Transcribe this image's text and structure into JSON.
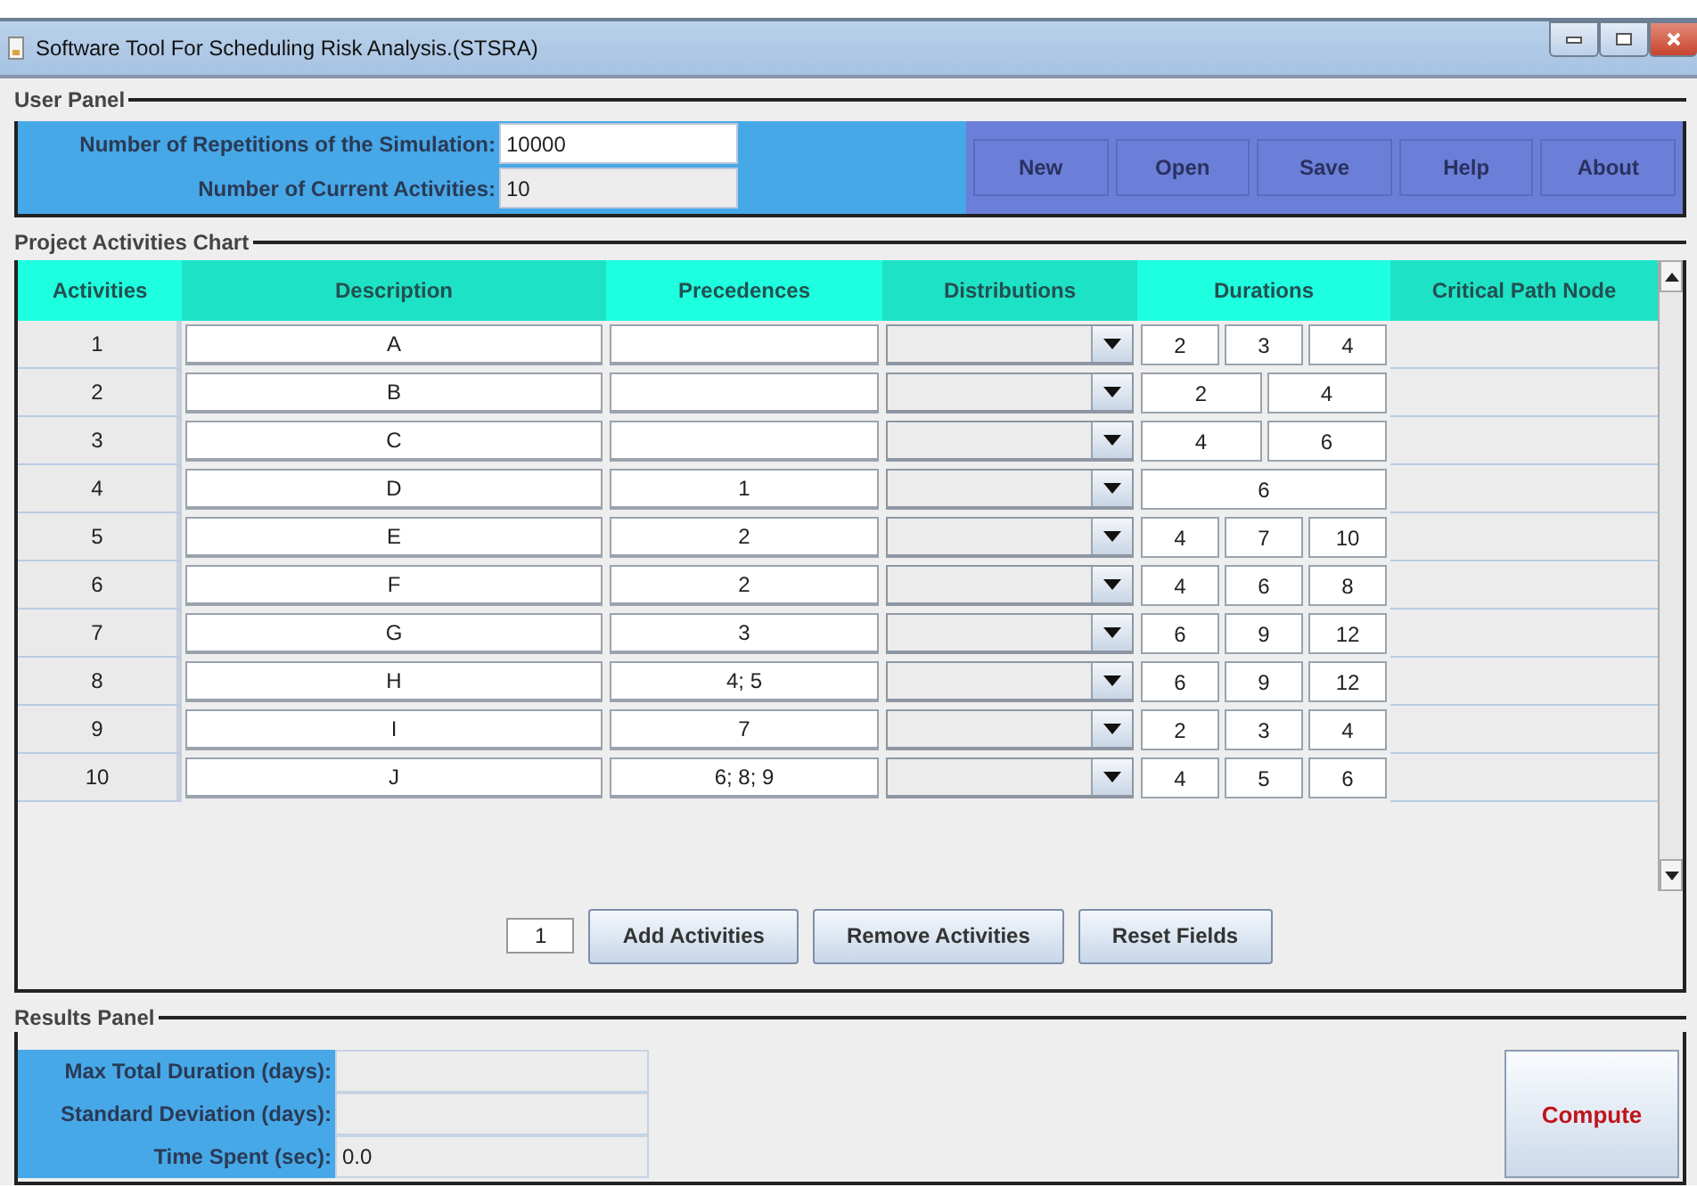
{
  "window": {
    "title": "Software Tool For Scheduling Risk Analysis.(STSRA)"
  },
  "user_panel": {
    "title": "User Panel",
    "fields": [
      {
        "label": "Number of Repetitions of the Simulation:",
        "value": "10000",
        "editable": true
      },
      {
        "label": "Number of Current Activities:",
        "value": "10",
        "editable": false
      }
    ],
    "buttons": [
      "New",
      "Open",
      "Save",
      "Help",
      "About"
    ]
  },
  "chart_panel": {
    "title": "Project Activities Chart",
    "columns": [
      "Activities",
      "Description",
      "Precedences",
      "Distributions",
      "Durations",
      "Critical Path Node"
    ],
    "rows": [
      {
        "activity": "1",
        "description": "A",
        "durations": [
          "2",
          "3",
          "4"
        ]
      },
      {
        "activity": "2",
        "description": "B",
        "durations": [
          "2",
          "4"
        ]
      },
      {
        "activity": "3",
        "description": "C",
        "durations": [
          "4",
          "6"
        ]
      },
      {
        "activity": "4",
        "description": "D",
        "precedences": "1",
        "durations": [
          "6"
        ]
      },
      {
        "activity": "5",
        "description": "E",
        "precedences": "2",
        "durations": [
          "4",
          "7",
          "10"
        ]
      },
      {
        "activity": "6",
        "description": "F",
        "precedences": "2",
        "durations": [
          "4",
          "6",
          "8"
        ]
      },
      {
        "activity": "7",
        "description": "G",
        "precedences": "3",
        "durations": [
          "6",
          "9",
          "12"
        ]
      },
      {
        "activity": "8",
        "description": "H",
        "precedences": "4; 5",
        "durations": [
          "6",
          "9",
          "12"
        ]
      },
      {
        "activity": "9",
        "description": "I",
        "precedences": "7",
        "durations": [
          "2",
          "3",
          "4"
        ]
      },
      {
        "activity": "10",
        "description": "J",
        "precedences": "6; 8; 9",
        "durations": [
          "4",
          "5",
          "6"
        ]
      }
    ],
    "count": "1",
    "buttons": [
      "Add Activities",
      "Remove Activities",
      "Reset Fields"
    ]
  },
  "results_panel": {
    "title": "Results Panel",
    "fields": [
      {
        "label": "Max Total Duration (days):"
      },
      {
        "label": "Standard Deviation (days):"
      },
      {
        "label": "Time Spent (sec):",
        "value": "0.0"
      }
    ],
    "compute_button": "Compute"
  }
}
